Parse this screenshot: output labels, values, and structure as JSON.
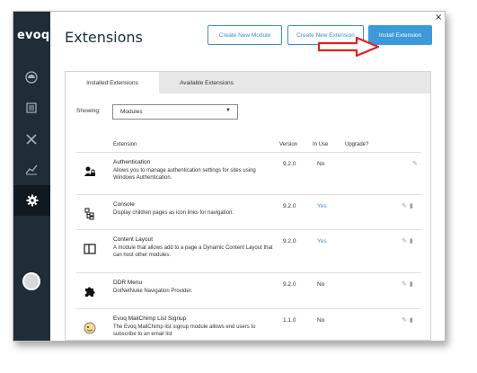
{
  "app": {
    "logo": "evoq",
    "title": "Extensions",
    "close": "×"
  },
  "sidebar": {
    "items": [
      {
        "icon": "gauge-icon"
      },
      {
        "icon": "pages-icon"
      },
      {
        "icon": "tools-icon"
      },
      {
        "icon": "chart-icon"
      },
      {
        "icon": "gear-icon",
        "active": true
      }
    ]
  },
  "header": {
    "create_new_module": "Create New Module",
    "create_new_extension": "Create New Extension",
    "install_extension": "Install Extension"
  },
  "tabs": [
    {
      "label": "Installed Extensions",
      "active": true
    },
    {
      "label": "Available Extensions",
      "active": false
    }
  ],
  "filter": {
    "label": "Showing:",
    "value": "Modules"
  },
  "columns": {
    "extension": "Extension",
    "version": "Version",
    "in_use": "In Use",
    "upgrade": "Upgrade?"
  },
  "rows": [
    {
      "name": "Authentication",
      "desc": "Allows you to manage authentication settings for sites using Windows Authentication.",
      "version": "9.2.0",
      "in_use": "No",
      "icon": "user-lock-icon"
    },
    {
      "name": "Console",
      "desc": "Display children pages as icon links for navigation.",
      "version": "9.2.0",
      "in_use": "Yes",
      "icon": "console-icon"
    },
    {
      "name": "Content Layout",
      "desc": "A module that allows add to a page a Dynamic Content Layout that can host other modules.",
      "version": "9.2.0",
      "in_use": "Yes",
      "icon": "layout-icon"
    },
    {
      "name": "DDR Menu",
      "desc": "DotNetNuke Navigation Provider.",
      "version": "9.2.0",
      "in_use": "No",
      "icon": "puzzle-icon"
    },
    {
      "name": "Evoq MailChimp List Signup",
      "desc": "The Evoq MailChimp list signup module allows end users to subscribe to an email list",
      "version": "1.1.0",
      "in_use": "No",
      "icon": "mailchimp-icon"
    }
  ],
  "colors": {
    "sidebar": "#1e2d37",
    "accent": "#3d9ad9",
    "annotation_arrow": "#e02020"
  }
}
